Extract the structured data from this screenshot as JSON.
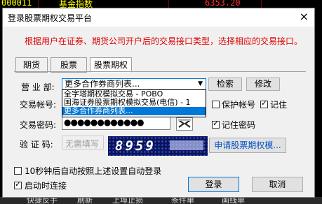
{
  "background": {
    "row_code": "000011",
    "row_name": "基金指数",
    "row_value": "6353.20",
    "bottom_items": [
      "快捷反手",
      "刷新",
      "上埠止损",
      "条件单",
      "画线单"
    ]
  },
  "dialog": {
    "title": "登录股票期权交易平台",
    "close_icon": "×",
    "notice": "根据用户在证券、期货公司开户后的交易接口类型，选择相应的交易接口。",
    "tabs": [
      "期货",
      "股票",
      "股票期权"
    ],
    "active_tab": "股票期权",
    "broker_label": "营 业 部:",
    "broker_value": "更多合作券商列表...",
    "search_button": "检索",
    "edit_button": "修改",
    "dropdown_items": [
      "全字塔期权模拟交易 - POBO",
      "国海证券股票期权模拟交易(电信) - 1",
      "更多合作券商列表..."
    ],
    "account_label": "交易帐号:",
    "account_value": "",
    "protect_account_label": "保护帐号",
    "remember_label": "记住",
    "password_label": "交易密码:",
    "password_value": "●●●●●●●●●●●●",
    "remember_password_label": "记住密码",
    "captcha_label": "验 证 码:",
    "captcha_placeholder": "无需填写",
    "captcha_code": "8959",
    "apply_button": "申请股票期权模...",
    "auto_login_label": "10秒钟后自动按照上述设置自动登录",
    "connect_on_start_label": "启动时连接",
    "login_button": "登录",
    "cancel_button": "取消"
  }
}
